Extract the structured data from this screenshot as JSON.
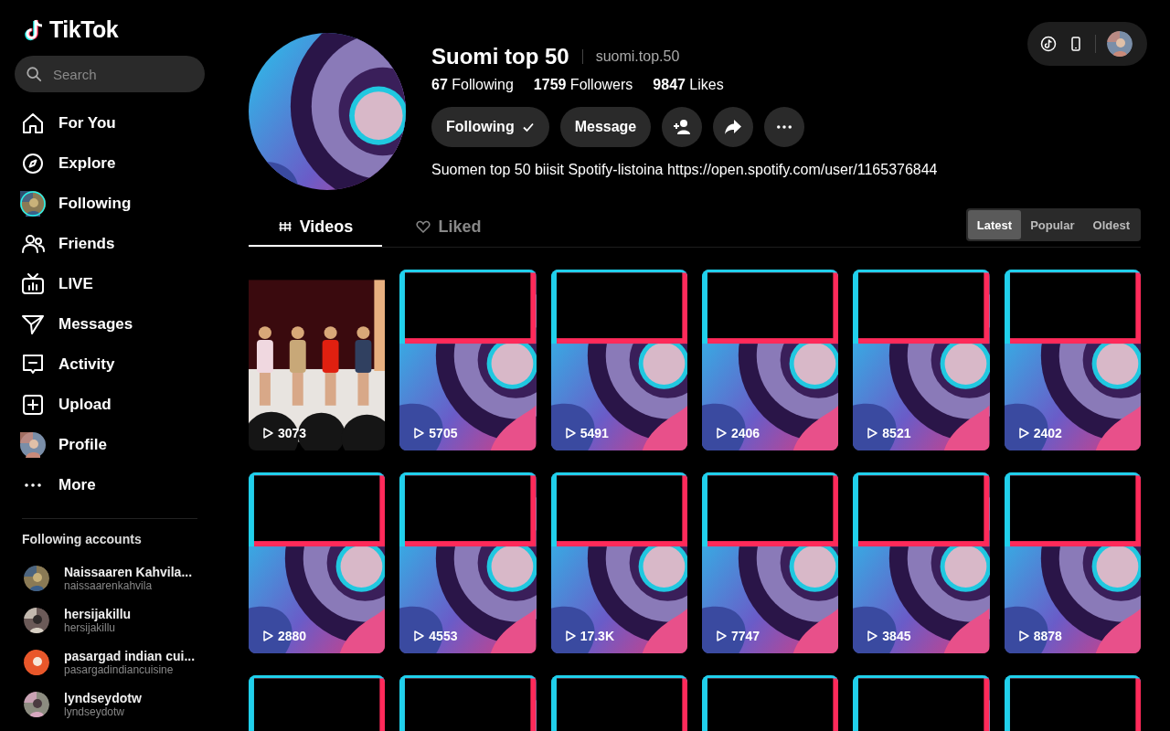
{
  "logo": {
    "text": "TikTok"
  },
  "search": {
    "placeholder": "Search"
  },
  "nav": [
    {
      "kind": "home",
      "label": "For You"
    },
    {
      "kind": "explore",
      "label": "Explore"
    },
    {
      "kind": "following",
      "label": "Following"
    },
    {
      "kind": "friends",
      "label": "Friends"
    },
    {
      "kind": "live",
      "label": "LIVE"
    },
    {
      "kind": "messages",
      "label": "Messages"
    },
    {
      "kind": "activity",
      "label": "Activity"
    },
    {
      "kind": "upload",
      "label": "Upload"
    },
    {
      "kind": "profile",
      "label": "Profile"
    },
    {
      "kind": "more",
      "label": "More"
    }
  ],
  "following_accounts": {
    "title": "Following accounts",
    "items": [
      {
        "name": "Naissaaren Kahvila...",
        "handle": "naissaarenkahvila"
      },
      {
        "name": "hersijakillu",
        "handle": "hersijakillu"
      },
      {
        "name": "pasargad indian cui...",
        "handle": "pasargadindiancuisine"
      },
      {
        "name": "lyndseydotw",
        "handle": "lyndseydotw"
      }
    ]
  },
  "profile": {
    "name": "Suomi top 50",
    "handle": "suomi.top.50",
    "stats": [
      "**67** Following",
      "**1759** Followers",
      "**9847** Likes"
    ],
    "buttons": [
      {
        "kind": "following",
        "label": "Following"
      },
      {
        "kind": "text",
        "label": "Message"
      },
      {
        "kind": "add-friend"
      },
      {
        "kind": "share"
      },
      {
        "kind": "more"
      }
    ],
    "bio": "Suomen top 50 biisit Spotify-listoina https://open.spotify.com/user/1165376844"
  },
  "tabs": [
    {
      "kind": "videos",
      "label": "Videos",
      "selected": true
    },
    {
      "kind": "liked",
      "label": "Liked",
      "selected": false
    }
  ],
  "sort": [
    {
      "label": "Latest",
      "selected": true
    },
    {
      "label": "Popular",
      "selected": false
    },
    {
      "label": "Oldest",
      "selected": false
    }
  ],
  "videos": [
    {
      "kind": "stage",
      "views": "3073"
    },
    {
      "kind": "disc",
      "views": "5705"
    },
    {
      "kind": "disc",
      "views": "5491"
    },
    {
      "kind": "disc",
      "views": "2406"
    },
    {
      "kind": "disc",
      "views": "8521"
    },
    {
      "kind": "disc",
      "views": "2402"
    },
    {
      "kind": "disc",
      "views": "2880"
    },
    {
      "kind": "disc",
      "views": "4553"
    },
    {
      "kind": "disc",
      "views": "17.3K"
    },
    {
      "kind": "disc",
      "views": "7747"
    },
    {
      "kind": "disc",
      "views": "3845"
    },
    {
      "kind": "disc",
      "views": "8878"
    },
    {
      "kind": "disc"
    },
    {
      "kind": "disc"
    },
    {
      "kind": "disc"
    },
    {
      "kind": "disc"
    },
    {
      "kind": "disc"
    },
    {
      "kind": "disc"
    }
  ]
}
